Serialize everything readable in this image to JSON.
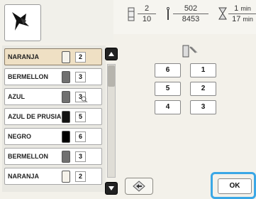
{
  "header": {
    "thread_current": "2",
    "thread_total": "10",
    "stitch_current": "502",
    "stitch_total": "8453",
    "time_current": "1",
    "time_total": "17",
    "time_unit": "min"
  },
  "thread_list": [
    {
      "name": "NARANJA",
      "number": "2",
      "spool": "#f5f2ea",
      "selected": true
    },
    {
      "name": "BERMELLON",
      "number": "3",
      "spool": "#707070",
      "selected": false
    },
    {
      "name": "AZUL",
      "number": "3",
      "spool": "#707070",
      "selected": false
    },
    {
      "name": "AZUL DE PRUSIA",
      "number": "5",
      "spool": "#111111",
      "selected": false
    },
    {
      "name": "NEGRO",
      "number": "6",
      "spool": "#000000",
      "selected": false
    },
    {
      "name": "BERMELLON",
      "number": "3",
      "spool": "#707070",
      "selected": false
    },
    {
      "name": "NARANJA",
      "number": "2",
      "spool": "#f5f2ea",
      "selected": false
    }
  ],
  "grid_values": [
    "6",
    "1",
    "5",
    "2",
    "4",
    "3"
  ],
  "buttons": {
    "ok_label": "OK"
  }
}
